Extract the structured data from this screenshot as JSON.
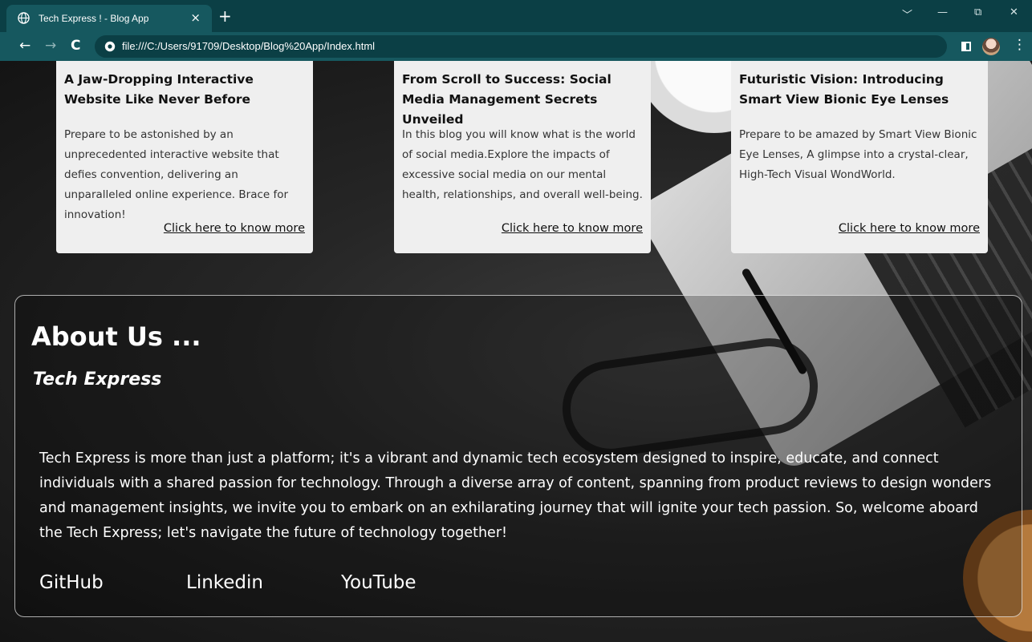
{
  "browser": {
    "tab_title": "Tech Express ! - Blog App",
    "tab_close": "×",
    "new_tab": "+",
    "url": "file:///C:/Users/91709/Desktop/Blog%20App/Index.html",
    "controls": {
      "dropdown": "﹀",
      "minimize": "—",
      "restore": "⧉",
      "close": "✕"
    },
    "nav": {
      "back": "←",
      "forward": "→",
      "reload": "C"
    },
    "menu": "⋮"
  },
  "blogs": [
    {
      "title": "A Jaw-Dropping Interactive Website Like Never Before",
      "text": "Prepare to be astonished by an unprecedented interactive website that defies convention, delivering an unparalleled online experience. Brace for innovation!",
      "link": "Click here to know more"
    },
    {
      "title": "From Scroll to Success: Social Media Management Secrets Unveiled",
      "text": "In this blog you will know what is the world of social media.Explore the impacts of excessive social media on our mental health, relationships, and overall well-being.",
      "link": "Click here to know more"
    },
    {
      "title": "Futuristic Vision: Introducing Smart View Bionic Eye Lenses",
      "text": "Prepare to be amazed by Smart View Bionic Eye Lenses, A glimpse into a crystal-clear, High-Tech Visual WondWorld.",
      "link": "Click here to know more"
    }
  ],
  "about": {
    "heading": "About Us ...",
    "subheading": "Tech Express",
    "text": "Tech Express is more than just a platform; it's a vibrant and dynamic tech ecosystem designed to inspire, educate, and connect individuals with a shared passion for technology. Through a diverse array of content, spanning from product reviews to design wonders and management insights, we invite you to embark on an exhilarating journey that will ignite your tech passion. So, welcome aboard the Tech Express; let's navigate the future of technology together!",
    "links": [
      "GitHub",
      "Linkedin",
      "YouTube"
    ]
  },
  "colors": {
    "chrome_dark": "#0b3f45",
    "chrome_light": "#16585f",
    "card_bg": "#efefef"
  },
  "icons": [
    "globe-icon",
    "info-icon",
    "side-panel-icon",
    "profile-avatar",
    "menu-icon"
  ]
}
